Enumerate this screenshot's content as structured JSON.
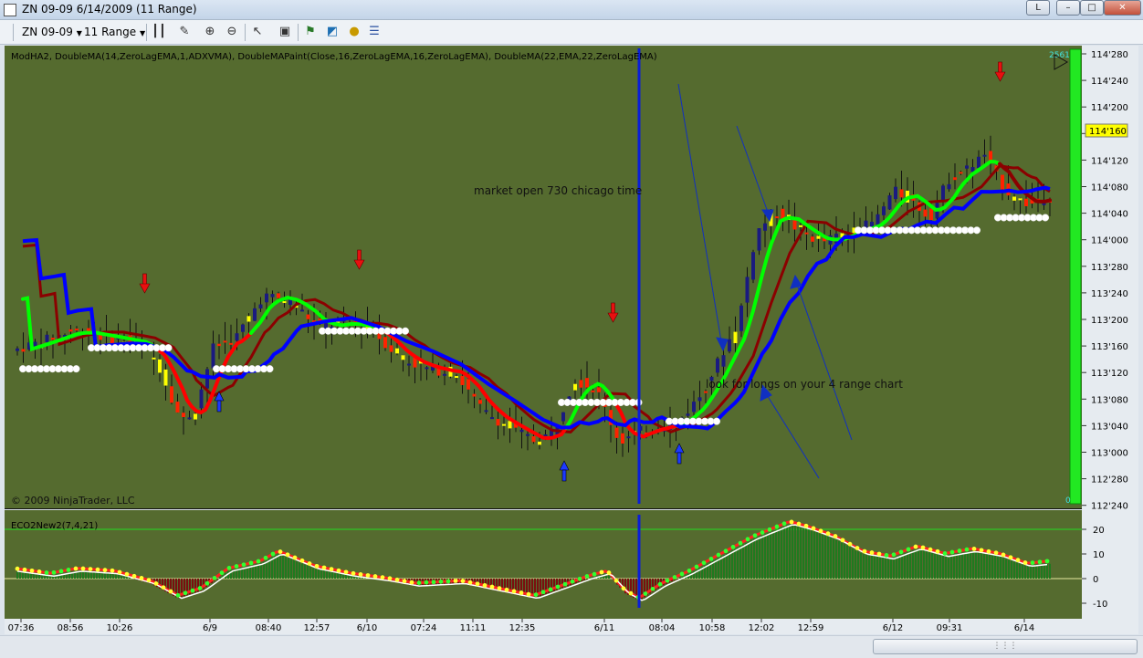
{
  "window": {
    "title": "ZN 09-09  6/14/2009 (11 Range)",
    "btn_l": "L",
    "btn_min": "–",
    "btn_max": "□",
    "btn_close": "✕"
  },
  "toolbar": {
    "instrument": "ZN 09-09",
    "period": "11 Range"
  },
  "chart": {
    "indicator_label": "ModHA2, DoubleMA(14,ZeroLagEMA,1,ADXVMA), DoubleMAPaint(Close,16,ZeroLagEMA,16,ZeroLagEMA), DoubleMA(22,EMA,22,ZeroLagEMA)",
    "copyright": "© 2009 NinjaTrader, LLC",
    "current_price": "114'160",
    "counter_top": "2561",
    "counter_bottom": "0",
    "annotation_open": "market open 730 chicago time",
    "annotation_longs": "look for longs on your 4 range chart",
    "price_ticks": [
      "114'280",
      "114'240",
      "114'200",
      "114'160",
      "114'120",
      "114'080",
      "114'040",
      "114'000",
      "113'280",
      "113'240",
      "113'200",
      "113'160",
      "113'120",
      "113'080",
      "113'040",
      "113'000",
      "112'280",
      "112'240"
    ],
    "time_ticks": [
      "07:36",
      "08:56",
      "10:26",
      "6/9",
      "08:40",
      "12:57",
      "6/10",
      "07:24",
      "11:11",
      "12:35",
      "6/11",
      "08:04",
      "10:58",
      "12:02",
      "12:59",
      "6/12",
      "09:31",
      "6/14"
    ],
    "colors": {
      "background": "#556b2f",
      "up_trend": "#00ff00",
      "down_trend": "#ff0000",
      "slow_ma": "#0000ff",
      "candle_up": "#1a1a80",
      "candle_down": "#ff2200",
      "candle_neutral": "#ffff00"
    }
  },
  "oscillator": {
    "label": "ECO2New2(7,4,21)",
    "ticks": [
      "20",
      "10",
      "0",
      "-10"
    ]
  },
  "chart_data": {
    "type": "line",
    "title": "ZN 09-09  6/14/2009 (11 Range)",
    "ylim": [
      112.75,
      114.9
    ],
    "x": [
      "07:36",
      "08:56",
      "10:26",
      "6/9",
      "08:40",
      "12:57",
      "6/10",
      "07:24",
      "11:11",
      "12:35",
      "6/11",
      "08:04",
      "10:58",
      "12:02",
      "12:59",
      "6/12",
      "09:31",
      "6/14"
    ],
    "series": [
      {
        "name": "ModHA2",
        "values": [
          113.45,
          113.5,
          113.55,
          113.1,
          113.75,
          113.85,
          113.65,
          113.45,
          113.3,
          113.05,
          113.2,
          113.15,
          113.4,
          114.2,
          114.0,
          114.35,
          114.45,
          114.5
        ]
      }
    ],
    "oscillator": {
      "name": "ECO2New2(7,4,21)",
      "ylim": [
        -12,
        25
      ],
      "values": [
        3,
        1,
        2,
        -8,
        4,
        2,
        1,
        -4,
        -2,
        -6,
        0,
        -8,
        2,
        18,
        24,
        12,
        10,
        5
      ]
    }
  }
}
